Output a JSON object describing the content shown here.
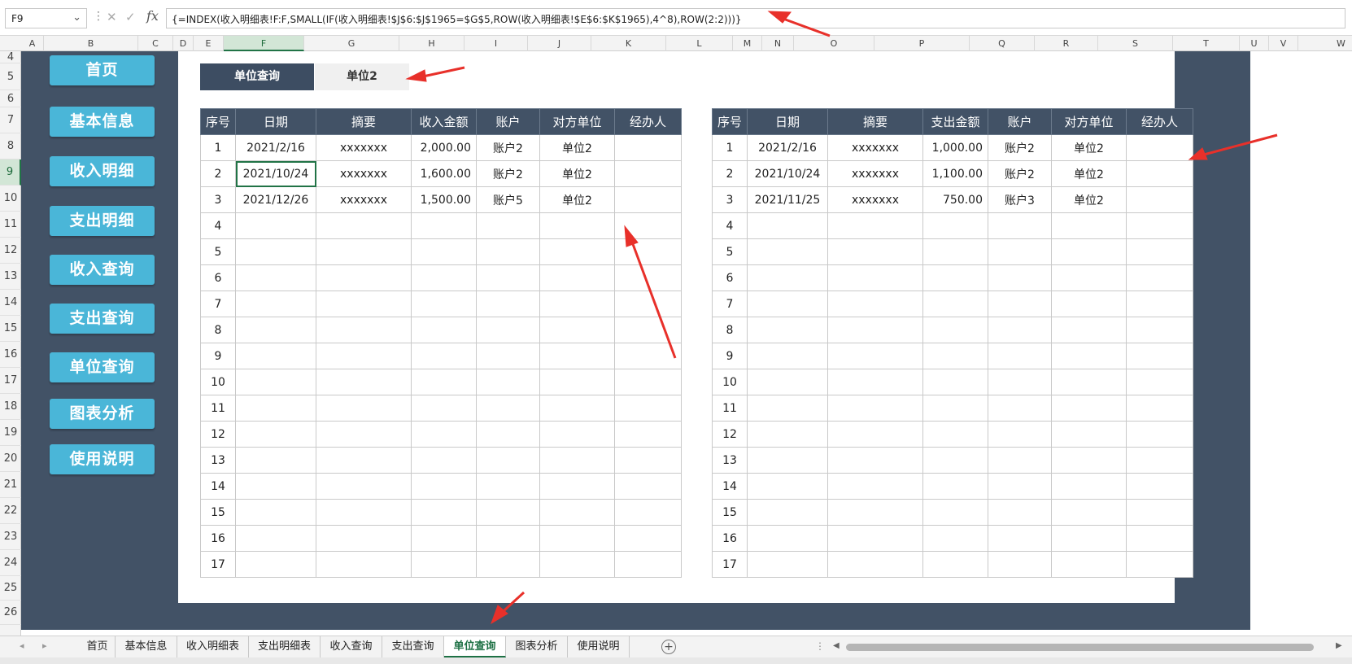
{
  "formula_bar": {
    "name_box": "F9",
    "formula": "{=INDEX(收入明细表!F:F,SMALL(IF(收入明细表!$J$6:$J$1965=$G$5,ROW(收入明细表!$E$6:$K$1965),4^8),ROW(2:2)))}",
    "fx_label": "fx"
  },
  "columns": [
    "A",
    "B",
    "C",
    "D",
    "E",
    "F",
    "G",
    "H",
    "I",
    "J",
    "K",
    "L",
    "M",
    "N",
    "O",
    "P",
    "Q",
    "R",
    "S",
    "T",
    "U",
    "V",
    "W"
  ],
  "selected_column": "F",
  "rows": [
    "4",
    "5",
    "6",
    "7",
    "8",
    "9",
    "10",
    "11",
    "12",
    "13",
    "14",
    "15",
    "16",
    "17",
    "18",
    "19",
    "20",
    "21",
    "22",
    "23",
    "24",
    "25",
    "26"
  ],
  "selected_row": "9",
  "nav_buttons": [
    "首页",
    "基本信息",
    "收入明细",
    "支出明细",
    "收入查询",
    "支出查询",
    "单位查询",
    "图表分析",
    "使用说明"
  ],
  "query": {
    "label": "单位查询",
    "value": "单位2"
  },
  "income_table": {
    "headers": [
      "序号",
      "日期",
      "摘要",
      "收入金额",
      "账户",
      "对方单位",
      "经办人"
    ],
    "rows": [
      [
        "1",
        "2021/2/16",
        "xxxxxxx",
        "2,000.00",
        "账户2",
        "单位2",
        ""
      ],
      [
        "2",
        "2021/10/24",
        "xxxxxxx",
        "1,600.00",
        "账户2",
        "单位2",
        ""
      ],
      [
        "3",
        "2021/12/26",
        "xxxxxxx",
        "1,500.00",
        "账户5",
        "单位2",
        ""
      ],
      [
        "4",
        "",
        "",
        "",
        "",
        "",
        ""
      ],
      [
        "5",
        "",
        "",
        "",
        "",
        "",
        ""
      ],
      [
        "6",
        "",
        "",
        "",
        "",
        "",
        ""
      ],
      [
        "7",
        "",
        "",
        "",
        "",
        "",
        ""
      ],
      [
        "8",
        "",
        "",
        "",
        "",
        "",
        ""
      ],
      [
        "9",
        "",
        "",
        "",
        "",
        "",
        ""
      ],
      [
        "10",
        "",
        "",
        "",
        "",
        "",
        ""
      ],
      [
        "11",
        "",
        "",
        "",
        "",
        "",
        ""
      ],
      [
        "12",
        "",
        "",
        "",
        "",
        "",
        ""
      ],
      [
        "13",
        "",
        "",
        "",
        "",
        "",
        ""
      ],
      [
        "14",
        "",
        "",
        "",
        "",
        "",
        ""
      ],
      [
        "15",
        "",
        "",
        "",
        "",
        "",
        ""
      ],
      [
        "16",
        "",
        "",
        "",
        "",
        "",
        ""
      ],
      [
        "17",
        "",
        "",
        "",
        "",
        "",
        ""
      ]
    ]
  },
  "expense_table": {
    "headers": [
      "序号",
      "日期",
      "摘要",
      "支出金额",
      "账户",
      "对方单位",
      "经办人"
    ],
    "rows": [
      [
        "1",
        "2021/2/16",
        "xxxxxxx",
        "1,000.00",
        "账户2",
        "单位2",
        ""
      ],
      [
        "2",
        "2021/10/24",
        "xxxxxxx",
        "1,100.00",
        "账户2",
        "单位2",
        ""
      ],
      [
        "3",
        "2021/11/25",
        "xxxxxxx",
        "750.00",
        "账户3",
        "单位2",
        ""
      ],
      [
        "4",
        "",
        "",
        "",
        "",
        "",
        ""
      ],
      [
        "5",
        "",
        "",
        "",
        "",
        "",
        ""
      ],
      [
        "6",
        "",
        "",
        "",
        "",
        "",
        ""
      ],
      [
        "7",
        "",
        "",
        "",
        "",
        "",
        ""
      ],
      [
        "8",
        "",
        "",
        "",
        "",
        "",
        ""
      ],
      [
        "9",
        "",
        "",
        "",
        "",
        "",
        ""
      ],
      [
        "10",
        "",
        "",
        "",
        "",
        "",
        ""
      ],
      [
        "11",
        "",
        "",
        "",
        "",
        "",
        ""
      ],
      [
        "12",
        "",
        "",
        "",
        "",
        "",
        ""
      ],
      [
        "13",
        "",
        "",
        "",
        "",
        "",
        ""
      ],
      [
        "14",
        "",
        "",
        "",
        "",
        "",
        ""
      ],
      [
        "15",
        "",
        "",
        "",
        "",
        "",
        ""
      ],
      [
        "16",
        "",
        "",
        "",
        "",
        "",
        ""
      ],
      [
        "17",
        "",
        "",
        "",
        "",
        "",
        ""
      ]
    ]
  },
  "sheet_tabs": [
    "首页",
    "基本信息",
    "收入明细表",
    "支出明细表",
    "收入查询",
    "支出查询",
    "单位查询",
    "图表分析",
    "使用说明"
  ],
  "active_tab": "单位查询",
  "colors": {
    "sidebar": "#425266",
    "nav_button": "#4ab6d8",
    "accent_green": "#1e7145",
    "annotation_arrow": "#e8302a"
  }
}
